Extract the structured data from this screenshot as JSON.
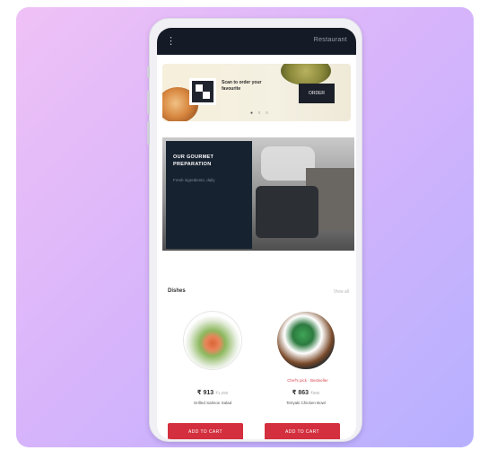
{
  "topbar": {
    "menu_icon": "vertical-dots-icon",
    "right_text": "Restaurant"
  },
  "promo": {
    "headline": "Scan to order your favourite",
    "badge": "ORDER",
    "carousel_dots": "● ○ ○"
  },
  "feature": {
    "title": "OUR GOURMET PREPARATION",
    "subtitle": "Fresh ingredients, daily"
  },
  "menu": {
    "section_title": "Dishes",
    "section_link": "View all",
    "dishes": [
      {
        "tag": "",
        "price": "₹ 913",
        "old_price": "₹1,090",
        "name": "Grilled Salmon Salad",
        "button": "ADD TO CART"
      },
      {
        "tag": "Chef's pick · Bestseller",
        "price": "₹ 863",
        "old_price": "₹990",
        "name": "Teriyaki Chicken Bowl",
        "button": "ADD TO CART"
      }
    ]
  },
  "colors": {
    "accent": "#d32f3e",
    "header": "#151b26",
    "feature_panel": "#172230",
    "gradient_start": "#efc1f6",
    "gradient_end": "#b6b0ff"
  }
}
